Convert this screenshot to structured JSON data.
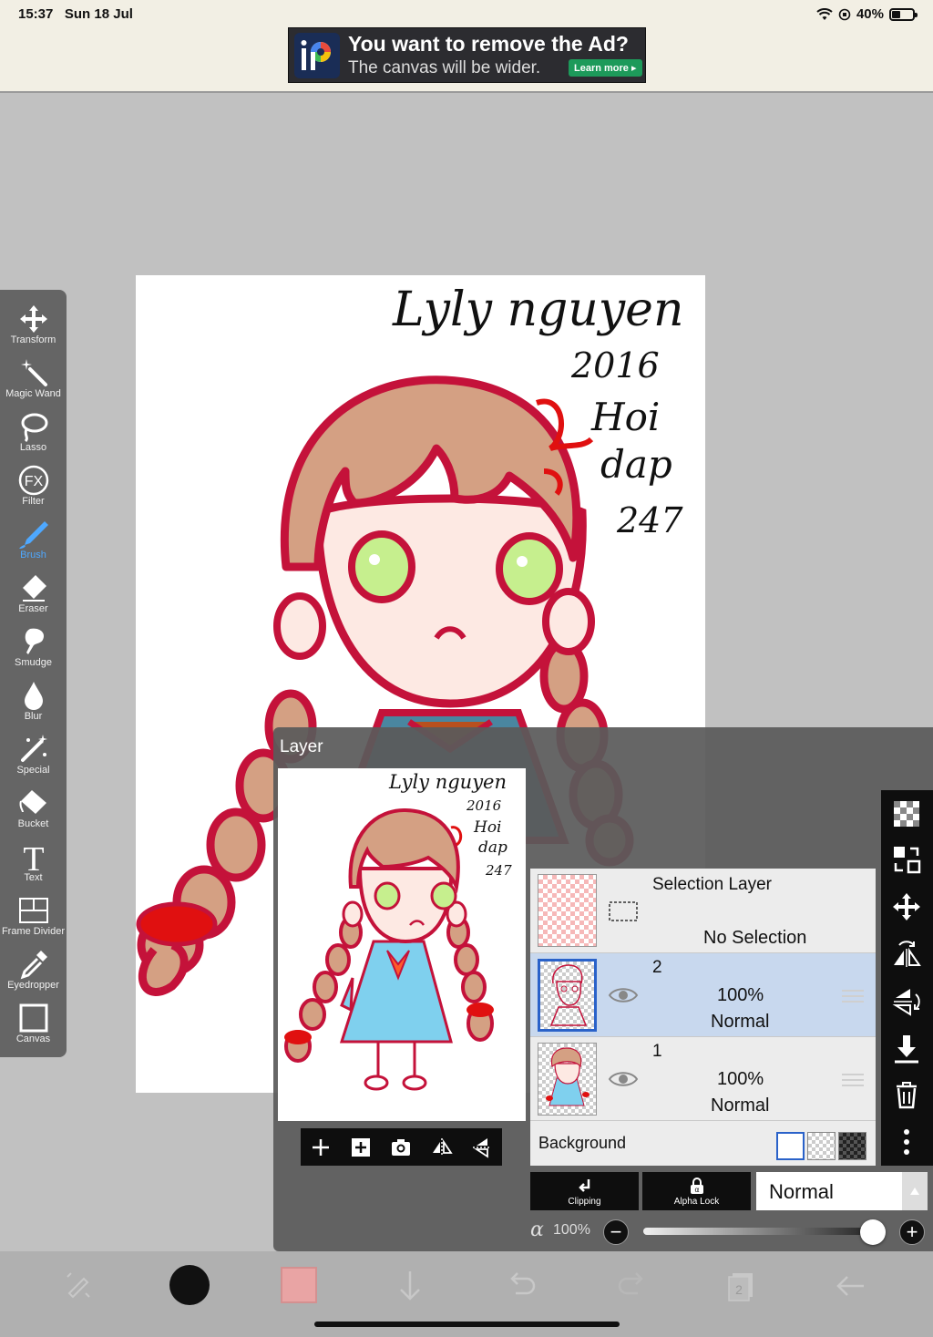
{
  "status": {
    "time": "15:37",
    "date": "Sun 18 Jul",
    "battery": "40%"
  },
  "ad": {
    "title": "You want to remove the Ad?",
    "subtitle": "The canvas will be wider.",
    "button": "Learn more ▸"
  },
  "tools": [
    {
      "label": "Transform",
      "icon": "move-icon"
    },
    {
      "label": "Magic Wand",
      "icon": "magic-wand-icon"
    },
    {
      "label": "Lasso",
      "icon": "lasso-icon"
    },
    {
      "label": "Filter",
      "icon": "fx-icon"
    },
    {
      "label": "Brush",
      "icon": "brush-icon",
      "active": true
    },
    {
      "label": "Eraser",
      "icon": "eraser-icon"
    },
    {
      "label": "Smudge",
      "icon": "smudge-icon"
    },
    {
      "label": "Blur",
      "icon": "drop-icon"
    },
    {
      "label": "Special",
      "icon": "special-icon"
    },
    {
      "label": "Bucket",
      "icon": "bucket-icon"
    },
    {
      "label": "Text",
      "icon": "text-icon"
    },
    {
      "label": "Frame Divider",
      "icon": "frame-divider-icon"
    },
    {
      "label": "Eyedropper",
      "icon": "eyedropper-icon"
    },
    {
      "label": "Canvas",
      "icon": "canvas-icon"
    }
  ],
  "canvas": {
    "signature_lines": [
      "Lyly nguyen",
      "2016",
      "Hoi",
      "dap",
      "247"
    ]
  },
  "layer_panel": {
    "title": "Layer",
    "selection_layer": {
      "name": "Selection Layer",
      "status": "No Selection"
    },
    "layers": [
      {
        "name": "2",
        "opacity": "100%",
        "blend": "Normal",
        "selected": true
      },
      {
        "name": "1",
        "opacity": "100%",
        "blend": "Normal",
        "selected": false
      }
    ],
    "background_label": "Background",
    "clipping_label": "Clipping",
    "alpha_lock_label": "Alpha Lock",
    "blend_mode": "Normal",
    "alpha_symbol": "α",
    "alpha_value": "100%",
    "minus": "−",
    "plus": "+"
  },
  "colors": {
    "accent": "#4ea8ff",
    "primary_color": "#111111",
    "secondary_color": "#f2a6a6",
    "line_red": "#c4123a",
    "hair": "#d4a083",
    "skin": "#fde9e3",
    "dress": "#7fd0ee"
  }
}
